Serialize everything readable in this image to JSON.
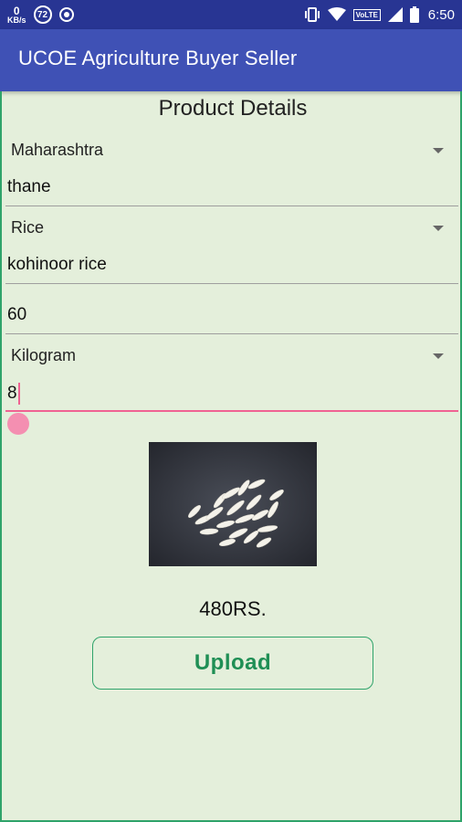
{
  "status_bar": {
    "net_speed_value": "0",
    "net_speed_unit": "KB/s",
    "notification_badge": "72",
    "volte_label": "VoLTE",
    "time": "6:50"
  },
  "app_bar": {
    "title": "UCOE Agriculture Buyer Seller"
  },
  "form": {
    "heading": "Product Details",
    "state_select": {
      "value": "Maharashtra"
    },
    "city_field": {
      "value": "thane"
    },
    "category_select": {
      "value": "Rice"
    },
    "product_name_field": {
      "value": "kohinoor rice"
    },
    "price_field": {
      "value": "60"
    },
    "unit_select": {
      "value": "Kilogram"
    },
    "quantity_field": {
      "value": "8"
    }
  },
  "total_price": "480RS.",
  "upload_button": {
    "label": "Upload"
  },
  "colors": {
    "status_bar": "#283593",
    "app_bar": "#3f51b5",
    "background": "#e4efdb",
    "accent": "#f06292",
    "button_text": "#1f8f55"
  },
  "icons": [
    "vibrate-icon",
    "wifi-icon",
    "signal-icon",
    "battery-icon",
    "dropdown-arrow-icon"
  ]
}
